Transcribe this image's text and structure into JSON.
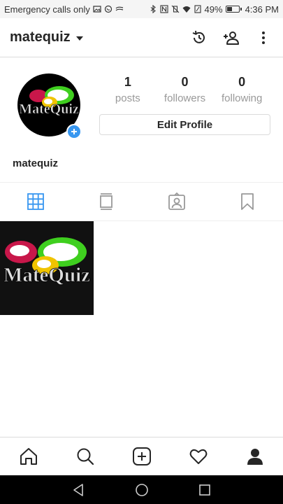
{
  "status_bar": {
    "carrier_text": "Emergency calls only",
    "battery_percent_label": "49%",
    "battery_level": 0.49,
    "time": "4:36 PM"
  },
  "header": {
    "username": "matequiz",
    "icons": [
      "history-icon",
      "add-person-icon",
      "more-vertical-icon"
    ]
  },
  "profile": {
    "avatar_logo_text": "MateQuiz",
    "stats": [
      {
        "value": "1",
        "label": "posts"
      },
      {
        "value": "0",
        "label": "followers"
      },
      {
        "value": "0",
        "label": "following"
      }
    ],
    "edit_button_label": "Edit Profile",
    "display_name": "matequiz"
  },
  "tabs": [
    {
      "icon": "grid-icon",
      "active": true
    },
    {
      "icon": "feed-icon",
      "active": false
    },
    {
      "icon": "tagged-icon",
      "active": false
    },
    {
      "icon": "saved-icon",
      "active": false
    }
  ],
  "posts": [
    {
      "logo_text": "MateQuiz"
    }
  ],
  "bottom_nav": [
    "home-icon",
    "search-icon",
    "add-post-icon",
    "activity-heart-icon",
    "profile-icon"
  ],
  "colors": {
    "accent": "#3897f0",
    "logo_red": "#c8174a",
    "logo_green": "#3fcf1f",
    "logo_yellow": "#f0c400"
  }
}
